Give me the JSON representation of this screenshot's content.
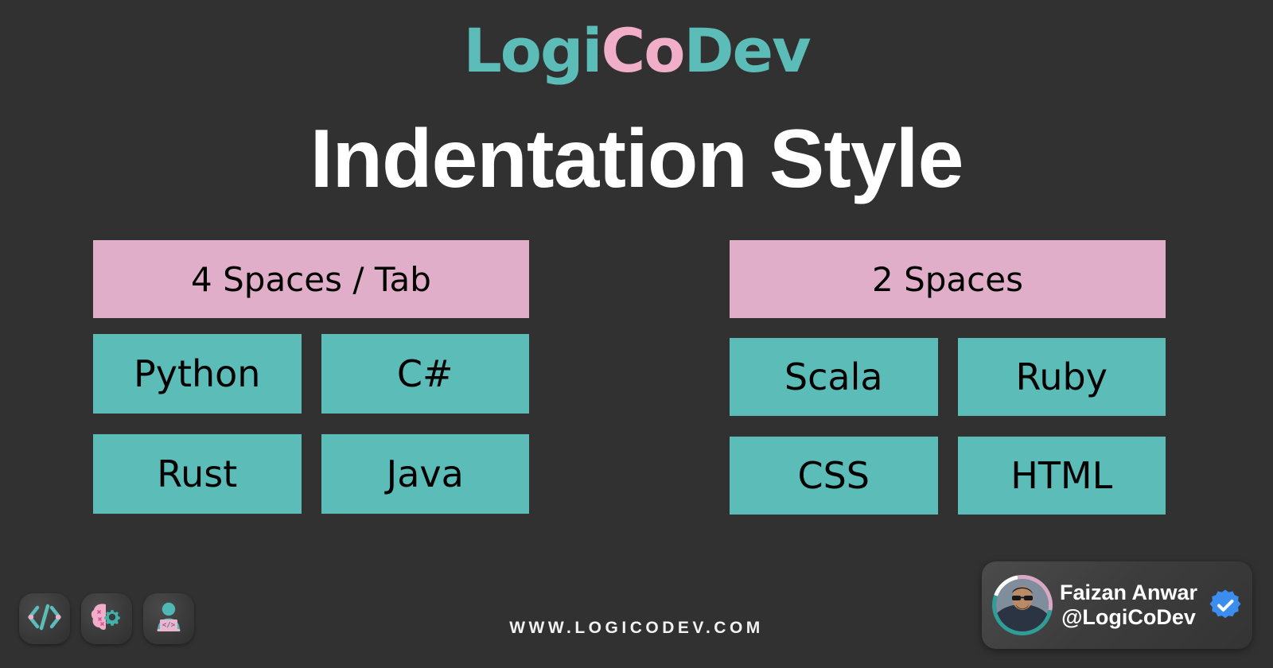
{
  "brand": {
    "logo_part1": "Logi",
    "logo_part2": "Co",
    "logo_part3": "Dev",
    "teal": "#5cbcb8",
    "pink": "#f0aec8"
  },
  "title": "Indentation Style",
  "columns": [
    {
      "header": "4 Spaces / Tab",
      "header_color": "#e0aec8",
      "languages": [
        "Python",
        "C#",
        "Rust",
        "Java"
      ],
      "language_color": "#5cbcb8"
    },
    {
      "header": "2 Spaces",
      "header_color": "#e0aec8",
      "languages": [
        "Scala",
        "Ruby",
        "CSS",
        "HTML"
      ],
      "language_color": "#5cbcb8"
    }
  ],
  "icons": [
    {
      "name": "code-brackets-icon"
    },
    {
      "name": "brain-gear-icon"
    },
    {
      "name": "developer-laptop-icon"
    }
  ],
  "footer": {
    "url": "WWW.LOGICODEV.COM"
  },
  "profile": {
    "name": "Faizan Anwar",
    "handle": "@LogiCoDev",
    "verified": true,
    "badge_color": "#3b8ef0"
  },
  "theme": {
    "background": "#313131",
    "text_light": "#ffffff",
    "text_dark": "#000000"
  }
}
